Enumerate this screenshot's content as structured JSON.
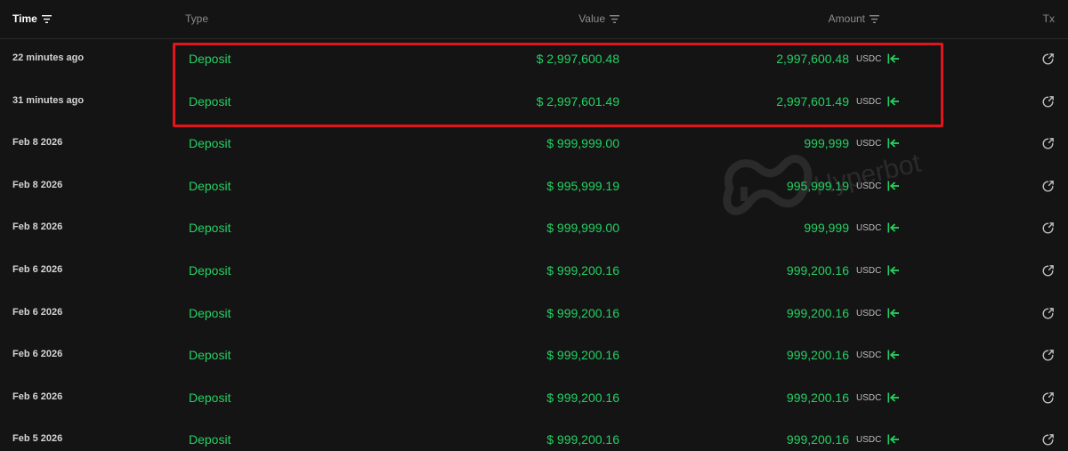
{
  "header": {
    "time": "Time",
    "type": "Type",
    "value": "Value",
    "amount": "Amount",
    "tx": "Tx"
  },
  "watermark": "Hyperbot",
  "colors": {
    "positive": "#25d063",
    "highlight": "#e3141b",
    "background": "#141414"
  },
  "rows": [
    {
      "time": "22 minutes ago",
      "type": "Deposit",
      "value": "$ 2,997,600.48",
      "amount": "2,997,600.48",
      "unit": "USDC"
    },
    {
      "time": "31 minutes ago",
      "type": "Deposit",
      "value": "$ 2,997,601.49",
      "amount": "2,997,601.49",
      "unit": "USDC"
    },
    {
      "time": "Feb 8 2026",
      "type": "Deposit",
      "value": "$ 999,999.00",
      "amount": "999,999",
      "unit": "USDC"
    },
    {
      "time": "Feb 8 2026",
      "type": "Deposit",
      "value": "$ 995,999.19",
      "amount": "995,999.19",
      "unit": "USDC"
    },
    {
      "time": "Feb 8 2026",
      "type": "Deposit",
      "value": "$ 999,999.00",
      "amount": "999,999",
      "unit": "USDC"
    },
    {
      "time": "Feb 6 2026",
      "type": "Deposit",
      "value": "$ 999,200.16",
      "amount": "999,200.16",
      "unit": "USDC"
    },
    {
      "time": "Feb 6 2026",
      "type": "Deposit",
      "value": "$ 999,200.16",
      "amount": "999,200.16",
      "unit": "USDC"
    },
    {
      "time": "Feb 6 2026",
      "type": "Deposit",
      "value": "$ 999,200.16",
      "amount": "999,200.16",
      "unit": "USDC"
    },
    {
      "time": "Feb 6 2026",
      "type": "Deposit",
      "value": "$ 999,200.16",
      "amount": "999,200.16",
      "unit": "USDC"
    },
    {
      "time": "Feb 5 2026",
      "type": "Deposit",
      "value": "$ 999,200.16",
      "amount": "999,200.16",
      "unit": "USDC"
    }
  ]
}
